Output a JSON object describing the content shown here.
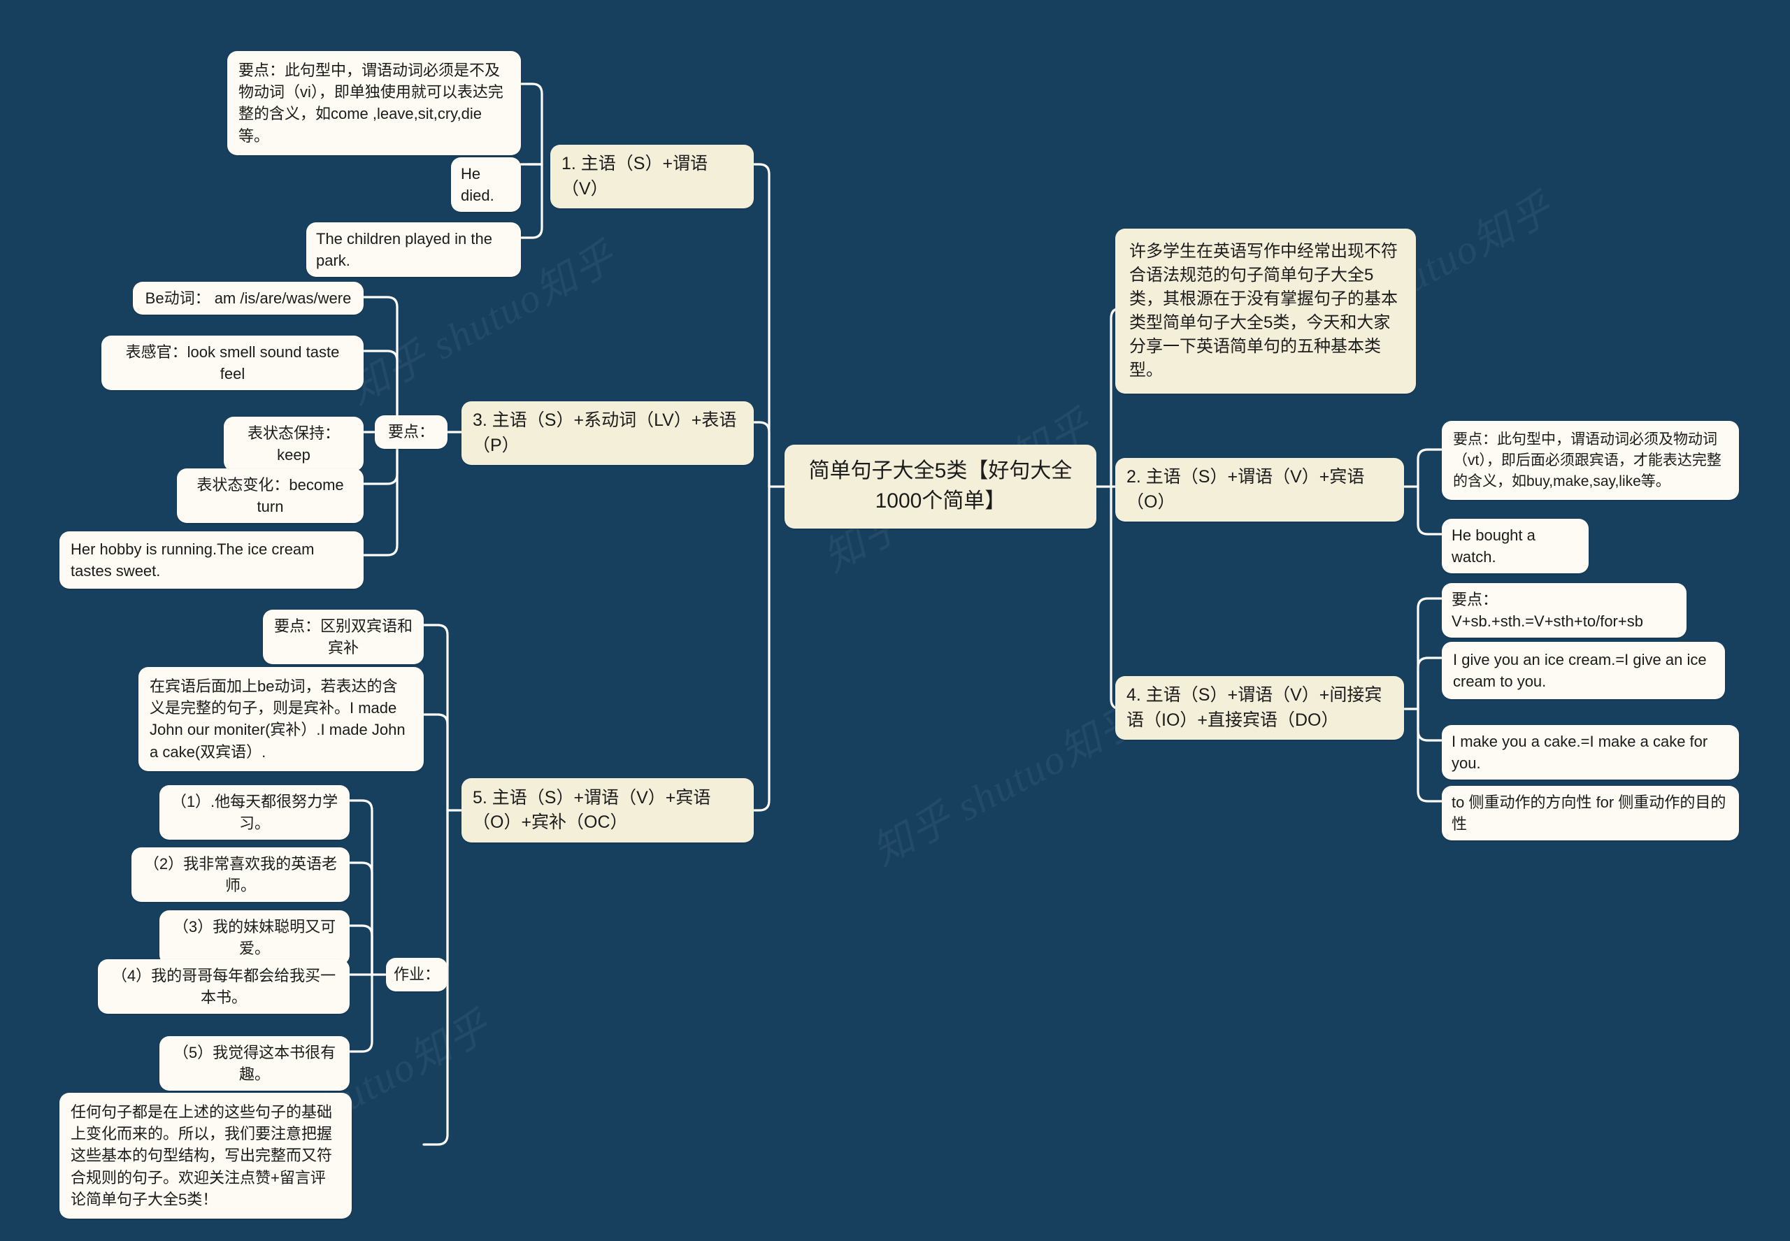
{
  "theme": {
    "background": "#17405f",
    "leaf_fill": "#fdfbf3",
    "topic_fill": "#f4efd9",
    "line_color": "#ffffff",
    "text_color": "#1b1b1b"
  },
  "watermark": {
    "text": "知乎 shutuo知乎"
  },
  "root": {
    "title": "简单句子大全5类【好句大全1000个简单】"
  },
  "intro": {
    "text": "许多学生在英语写作中经常出现不符合语法规范的句子简单句子大全5类，其根源在于没有掌握句子的基本类型简单句子大全5类，今天和大家分享一下英语简单句的五种基本类型。"
  },
  "branches": {
    "b1": {
      "label": "1. 主语（S）+谓语（V）",
      "children": [
        {
          "label": "要点：此句型中，谓语动词必须是不及物动词（vi），即单独使用就可以表达完整的含义，如come ,leave,sit,cry,die等。"
        },
        {
          "label": "He died."
        },
        {
          "label": "The children played in the park."
        }
      ]
    },
    "b2": {
      "label": "2. 主语（S）+谓语（V）+宾语（O）",
      "children": [
        {
          "label": "要点：此句型中，谓语动词必须及物动词（vt），即后面必须跟宾语，才能表达完整的含义，如buy,make,say,like等。"
        },
        {
          "label": "He bought a watch."
        }
      ]
    },
    "b3": {
      "label": "3. 主语（S）+系动词（LV）+表语（P）",
      "connector": "要点：",
      "children": [
        {
          "label": "Be动词： am /is/are/was/were"
        },
        {
          "label": "表感官：look smell sound taste feel"
        },
        {
          "label": "表状态保持：keep"
        },
        {
          "label": "表状态变化：become turn"
        },
        {
          "label": "Her hobby is running.The ice cream tastes sweet."
        }
      ]
    },
    "b4": {
      "label": "4. 主语（S）+谓语（V）+间接宾语（IO）+直接宾语（DO）",
      "children": [
        {
          "label": "要点：V+sb.+sth.=V+sth+to/for+sb"
        },
        {
          "label": "I give you an ice cream.=I give an ice cream to you."
        },
        {
          "label": "I make you a cake.=I make a cake for you."
        },
        {
          "label": "to 侧重动作的方向性 for 侧重动作的目的性"
        }
      ]
    },
    "b5": {
      "label": "5. 主语（S）+谓语（V）+宾语（O）+宾补（OC）",
      "direct_children": [
        {
          "label": "要点：区别双宾语和宾补"
        },
        {
          "label": "在宾语后面加上be动词，若表达的含义是完整的句子，则是宾补。I made John our moniter(宾补）.I made John a cake(双宾语）."
        },
        {
          "label": "任何句子都是在上述的这些句子的基础上变化而来的。所以，我们要注意把握这些基本的句型结构，写出完整而又符合规则的句子。欢迎关注点赞+留言评论简单句子大全5类！"
        }
      ],
      "connector": "作业：",
      "homework": [
        {
          "label": "（1）.他每天都很努力学习。"
        },
        {
          "label": "（2）我非常喜欢我的英语老师。"
        },
        {
          "label": "（3）我的妹妹聪明又可爱。"
        },
        {
          "label": "（4）我的哥哥每年都会给我买一本书。"
        },
        {
          "label": "（5）我觉得这本书很有趣。"
        }
      ]
    }
  }
}
